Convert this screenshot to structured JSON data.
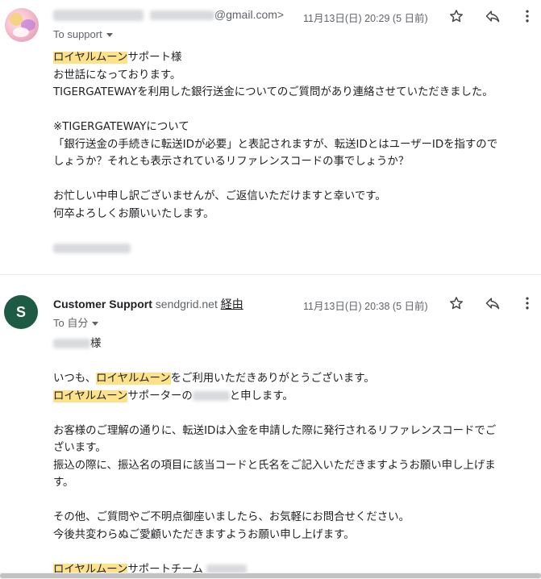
{
  "message1": {
    "sender_email_suffix": "@gmail.com>",
    "recipient_label": "To support",
    "date": "11月13日(日) 20:29 (5 日前)",
    "greeting_highlight": "ロイヤルムーン",
    "greeting_rest": "サポート様",
    "line1": "お世話になっております。",
    "line2": "TIGERGATEWAYを利用した銀行送金についてのご質問があり連絡させていただきました。",
    "line3": "※TIGERGATEWAYについて",
    "line4": "「銀行送金の手続きに転送IDが必要」と表記されますが、転送IDとはユーザーIDを指すので",
    "line5": "しょうか？それとも表示されているリファレンスコードの事でしょうか？",
    "line6": "お忙しい中申し訳ございませんが、ご返信いただけますと幸いです。",
    "line7": "何卒よろしくお願いいたします。"
  },
  "message2": {
    "avatar_letter": "S",
    "sender_name": "Customer Support",
    "sender_domain": "sendgrid.net",
    "via_label": "経由",
    "recipient_label": "To 自分",
    "date": "11月13日(日) 20:38 (5 日前)",
    "honorific": "様",
    "line1_a": "いつも、",
    "line1_hl": "ロイヤルムーン",
    "line1_b": "をご利用いただきありがとうございます。",
    "line2_hl": "ロイヤルムーン",
    "line2_a": "サポーターの",
    "line2_b": "と申します。",
    "line3": "お客様のご理解の通りに、転送IDは入金を申請した際に発行されるリファレンスコードでご",
    "line4": "ざいます。",
    "line5": "振込の際に、振込名の項目に該当コードと氏名をご記入いただきますようお願い申し上げま",
    "line6": "す。",
    "line7": "その他、ご質問やご不明点御座いましたら、お気軽にお問合せください。",
    "line8": "今後共変わらぬご愛顧いただきますようお願い申し上げます。",
    "sig_hl": "ロイヤルムーン",
    "sig_rest": "サポートチーム"
  },
  "icons": [
    "star-icon",
    "reply-icon",
    "more-vert-icon",
    "chevron-down-icon"
  ],
  "colors": {
    "highlight": "#fde28a",
    "avatar_s": "#1e5b45"
  }
}
